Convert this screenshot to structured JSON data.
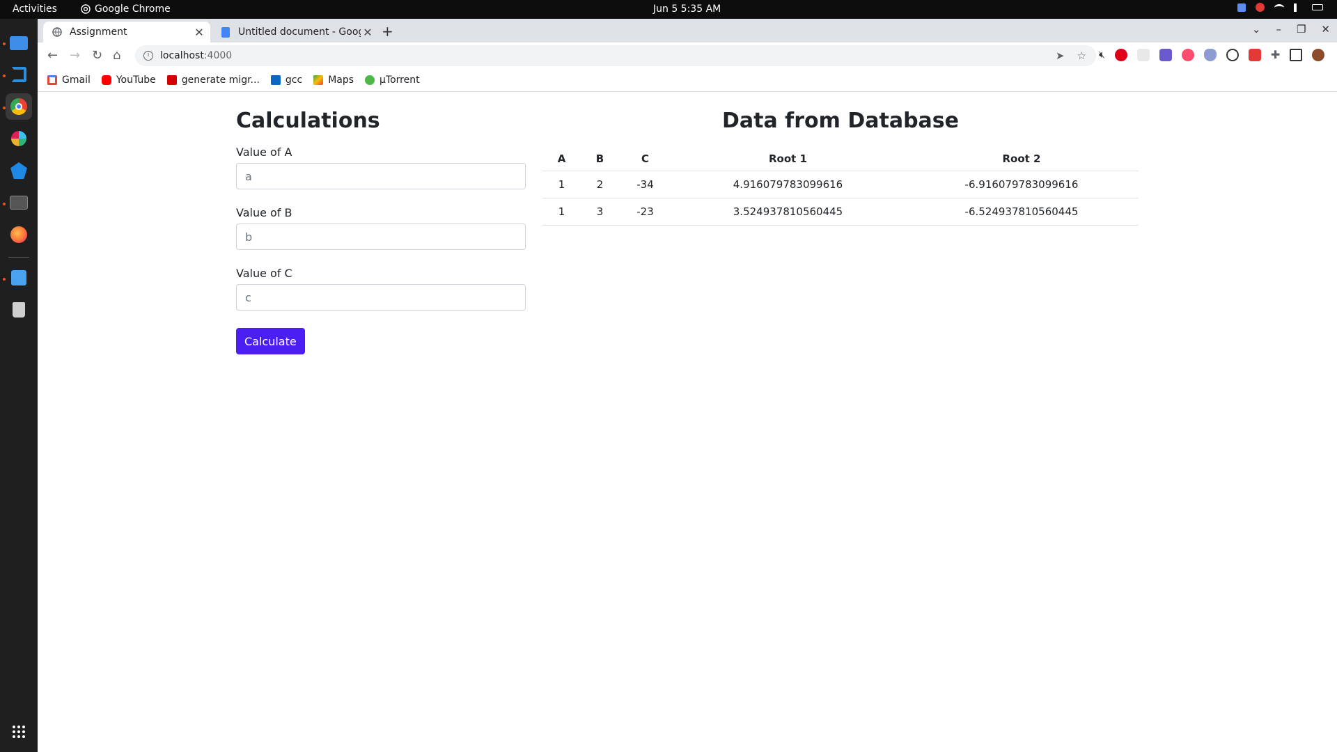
{
  "system": {
    "activities": "Activities",
    "app_name": "Google Chrome",
    "clock": "Jun 5   5:35 AM"
  },
  "browser": {
    "tabs": [
      {
        "label": "Assignment",
        "active": true
      },
      {
        "label": "Untitled document - Goog",
        "active": false
      }
    ],
    "url_host": "localhost",
    "url_port": ":4000",
    "bookmarks": [
      {
        "label": "Gmail",
        "icon": "gmail-icon",
        "color": "#ea4335"
      },
      {
        "label": "YouTube",
        "icon": "youtube-icon",
        "color": "#ff0000"
      },
      {
        "label": "generate migr...",
        "icon": "bookmark-red-icon",
        "color": "#d50000"
      },
      {
        "label": "gcc",
        "icon": "linkedin-icon",
        "color": "#0a66c2"
      },
      {
        "label": "Maps",
        "icon": "maps-icon",
        "color": "#34a853"
      },
      {
        "label": "µTorrent",
        "icon": "utorrent-icon",
        "color": "#4db848"
      }
    ]
  },
  "calc": {
    "title": "Calculations",
    "label_a": "Value of A",
    "placeholder_a": "a",
    "label_b": "Value of B",
    "placeholder_b": "b",
    "label_c": "Value of C",
    "placeholder_c": "c",
    "button": "Calculate",
    "accent": "#4b1ff3"
  },
  "db": {
    "title": "Data from Database",
    "headers": [
      "A",
      "B",
      "C",
      "Root 1",
      "Root 2"
    ],
    "rows": [
      [
        "1",
        "2",
        "-34",
        "4.916079783099616",
        "-6.916079783099616"
      ],
      [
        "1",
        "3",
        "-23",
        "3.524937810560445",
        "-6.524937810560445"
      ]
    ]
  }
}
